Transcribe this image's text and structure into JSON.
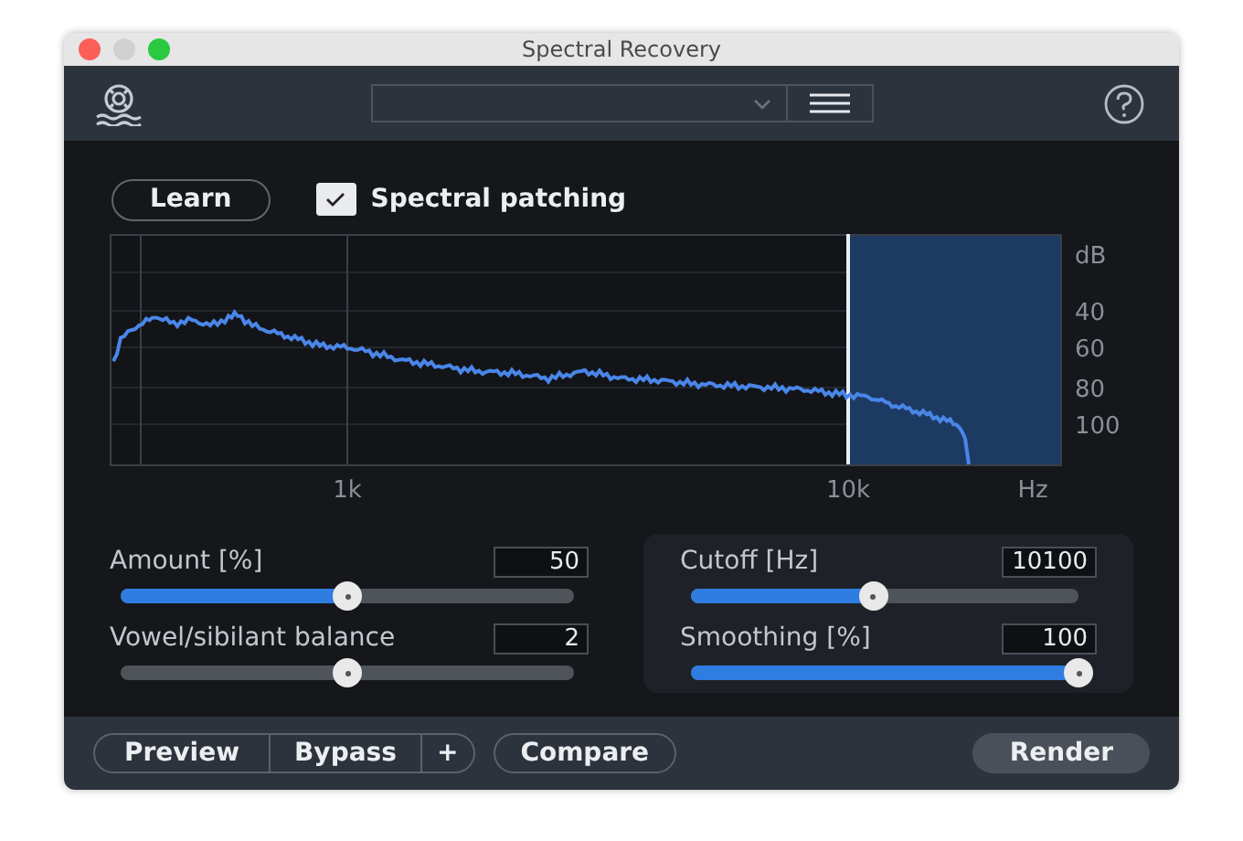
{
  "window": {
    "title": "Spectral Recovery"
  },
  "toolbar": {
    "preset_menu": {
      "expanded": false
    }
  },
  "learn_button": "Learn",
  "spectral_patching": {
    "label": "Spectral patching",
    "checked": true
  },
  "spectrum": {
    "y_unit": "dB",
    "y_ticks": [
      "40",
      "60",
      "80",
      "100"
    ],
    "x_ticks": [
      "1k",
      "10k"
    ],
    "x_unit": "Hz"
  },
  "sliders_left": [
    {
      "label": "Amount [%]",
      "value": "50",
      "level": 0.5,
      "kind": "fill"
    },
    {
      "label": "Vowel/sibilant balance",
      "value": "2",
      "level": 0.5,
      "kind": "plain"
    }
  ],
  "sliders_right": [
    {
      "label": "Cutoff [Hz]",
      "value": "10100",
      "level": 0.47,
      "kind": "fill"
    },
    {
      "label": "Smoothing [%]",
      "value": "100",
      "level": 1,
      "kind": "fill"
    }
  ],
  "footer": {
    "preview": "Preview",
    "bypass": "Bypass",
    "plus": "+",
    "compare": "Compare",
    "render": "Render"
  }
}
